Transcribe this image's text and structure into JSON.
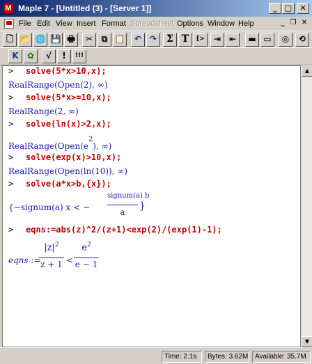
{
  "window": {
    "title": "Maple 7 - [Untitled (3) - [Server 1]]",
    "app_icon_glyph": "M",
    "controls": {
      "minimize": "_",
      "maximize": "□",
      "close": "✕"
    },
    "mdi_controls": {
      "minimize": "_",
      "restore": "❐",
      "close": "✕"
    }
  },
  "menu": {
    "items": [
      "File",
      "Edit",
      "View",
      "Insert",
      "Format",
      "Spreadsheet",
      "Options",
      "Window",
      "Help"
    ],
    "disabled": [
      "Spreadsheet"
    ]
  },
  "toolbar_main": {
    "buttons": [
      {
        "name": "new-icon",
        "glyph": "🗋"
      },
      {
        "name": "open-icon",
        "glyph": "📂"
      },
      {
        "name": "open-url-icon",
        "glyph": "🌐"
      },
      {
        "name": "save-icon",
        "glyph": "💾"
      },
      {
        "name": "print-icon",
        "glyph": "🖶"
      },
      {
        "name": "cut-icon",
        "glyph": "✂"
      },
      {
        "name": "copy-icon",
        "glyph": "⧉"
      },
      {
        "name": "paste-icon",
        "glyph": "📋"
      },
      {
        "name": "undo-icon",
        "glyph": "↶"
      },
      {
        "name": "redo-icon",
        "glyph": "↷"
      },
      {
        "name": "sigma-icon",
        "glyph": "Σ"
      },
      {
        "name": "text-icon",
        "glyph": "T"
      },
      {
        "name": "execution-group-icon",
        "glyph": "[>"
      },
      {
        "name": "indent-icon",
        "glyph": "⇥"
      },
      {
        "name": "outdent-icon",
        "glyph": "⇤"
      },
      {
        "name": "collapse-icon",
        "glyph": "▬"
      },
      {
        "name": "expand-icon",
        "glyph": "▭"
      },
      {
        "name": "stop-icon",
        "glyph": "◎"
      },
      {
        "name": "restart-icon",
        "glyph": "⟲"
      }
    ]
  },
  "toolbar_context": {
    "buttons": [
      {
        "name": "k-icon",
        "glyph": "K"
      },
      {
        "name": "maple-leaf-icon",
        "glyph": "✿"
      },
      {
        "name": "sqrt-icon",
        "glyph": "√"
      },
      {
        "name": "factorial-icon",
        "glyph": "!"
      },
      {
        "name": "triple-factorial-icon",
        "glyph": "!!!"
      }
    ]
  },
  "worksheet": {
    "prompt": ">",
    "inputs": [
      "solve(5*x>10,x);",
      "solve(5*x>=10,x);",
      "solve(ln(x)>2,x);",
      "solve(exp(x)>10,x);",
      "solve(a*x>b,{x});",
      "eqns:=abs(z)^2/(z+1)<exp(2)/(exp(1)-1);"
    ],
    "outputs": {
      "o1": "RealRange(Open(2), ∞)",
      "o2": "RealRange(2, ∞)",
      "o3_main": "RealRange(Open(e",
      "o3_exp": "2",
      "o3_tail": "), ∞)",
      "o4": "RealRange(Open(ln(10)), ∞)",
      "o5_left": "{−signum(a) x < −",
      "o5_num": "signum(a) b",
      "o5_den": "a",
      "o5_right": "}",
      "o6_lhs": "eqns :=",
      "o6_num1": "|z|",
      "o6_num1_exp": "2",
      "o6_den1": "z + 1",
      "o6_rel": "<",
      "o6_num2": "e",
      "o6_num2_exp": "2",
      "o6_den2": "e − 1"
    }
  },
  "scrollbar": {
    "up": "▲",
    "down": "▼"
  },
  "status": {
    "time": "Time:   2.1s",
    "bytes": "Bytes: 3.62M",
    "available": "Available: 35.7M"
  },
  "colors": {
    "input": "#c00000",
    "output": "#1a1ab0",
    "title_start": "#0a246a",
    "title_end": "#a6caf0"
  }
}
